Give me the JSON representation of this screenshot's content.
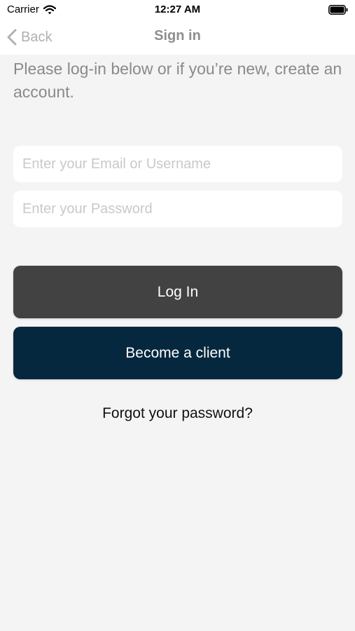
{
  "status_bar": {
    "carrier": "Carrier",
    "time": "12:27 AM"
  },
  "nav": {
    "back_label": "Back",
    "title": "Sign in"
  },
  "intro_text": "Please log-in below or if you’re new, create an account.",
  "form": {
    "email_placeholder": "Enter your Email or Username",
    "email_value": "",
    "password_placeholder": "Enter your Password",
    "password_value": ""
  },
  "buttons": {
    "login_label": "Log In",
    "client_label": "Become a client",
    "forgot_label": "Forgot your password?"
  },
  "colors": {
    "background": "#f4f4f4",
    "login_button": "#424242",
    "client_button": "#05283e",
    "back_tint": "#b0b0b0"
  },
  "icons": {
    "wifi": "wifi-icon",
    "battery": "battery-icon",
    "back": "chevron-left-icon"
  }
}
